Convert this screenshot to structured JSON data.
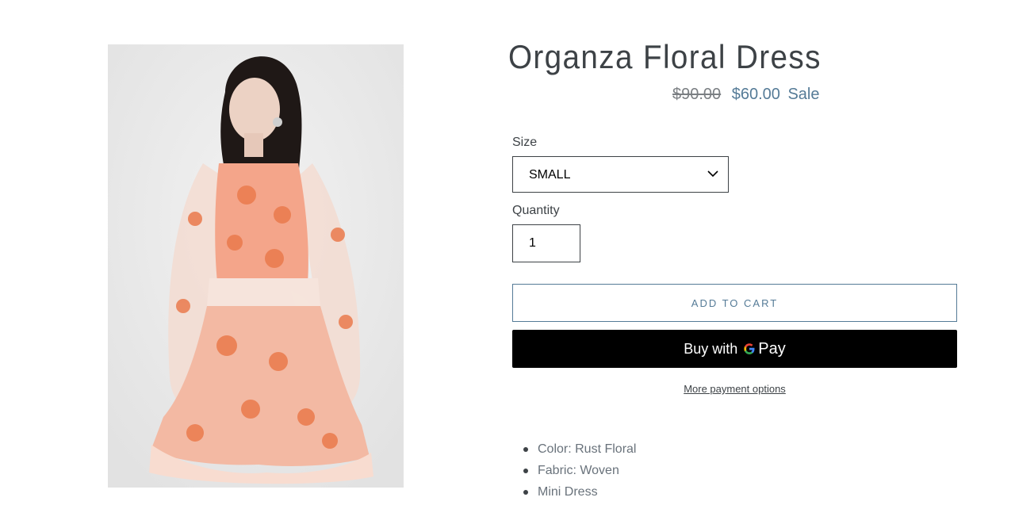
{
  "product": {
    "title": "Organza Floral Dress",
    "price_original": "$90.00",
    "price_sale": "$60.00",
    "sale_label": "Sale"
  },
  "size": {
    "label": "Size",
    "selected": "SMALL"
  },
  "quantity": {
    "label": "Quantity",
    "value": "1"
  },
  "buttons": {
    "add_to_cart": "ADD TO CART",
    "gpay_buy": "Buy with",
    "gpay_pay": "Pay",
    "more_payment": "More payment options"
  },
  "details": [
    "Color: Rust Floral",
    "Fabric: Woven",
    "Mini Dress"
  ],
  "colors": {
    "accent": "#557b97",
    "text": "#3d4246",
    "dress": "#f4a58a",
    "flower": "#ea7a4c"
  }
}
